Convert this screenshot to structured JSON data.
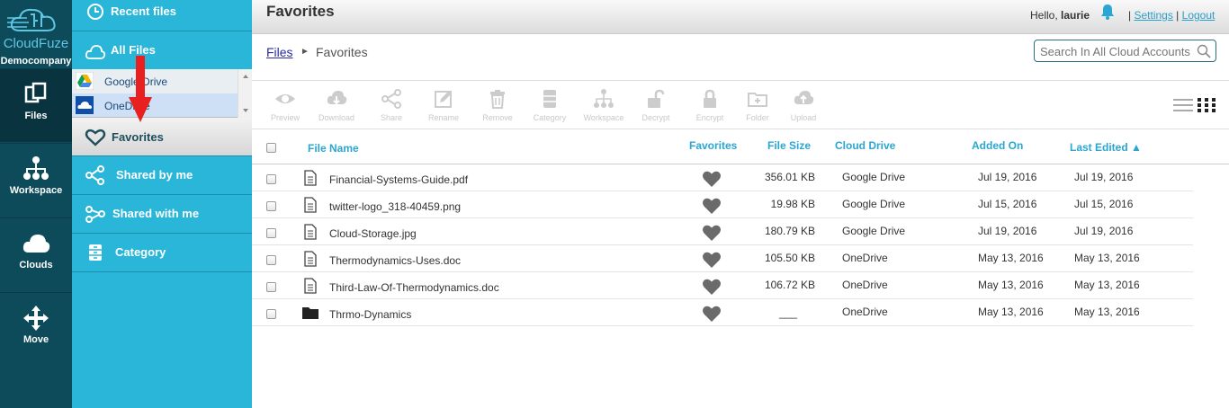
{
  "brand": {
    "name": "CloudFuze",
    "company": "Democompany"
  },
  "rail": [
    {
      "label": "Files",
      "icon": "files-icon"
    },
    {
      "label": "Workspace",
      "icon": "workspace-icon"
    },
    {
      "label": "Clouds",
      "icon": "clouds-icon"
    },
    {
      "label": "Move",
      "icon": "move-icon"
    }
  ],
  "sidebar": {
    "recent": "Recent files",
    "all_files": "All Files",
    "clouds": [
      {
        "label": "Google Drive",
        "icon": "google-drive-icon"
      },
      {
        "label": "OneDrive",
        "icon": "onedrive-icon"
      }
    ],
    "favorites": "Favorites",
    "shared_by_me": "Shared by me",
    "shared_with_me": "Shared with me",
    "category": "Category"
  },
  "header": {
    "title": "Favorites",
    "hello": "Hello,",
    "user": "laurie",
    "settings": "Settings",
    "logout": "Logout",
    "sep": "|"
  },
  "breadcrumb": {
    "root": "Files",
    "sep": "►",
    "current": "Favorites"
  },
  "search": {
    "placeholder": "Search In All Cloud Accounts"
  },
  "toolbar": [
    {
      "label": "Preview",
      "icon": "eye-icon"
    },
    {
      "label": "Download",
      "icon": "cloud-download-icon"
    },
    {
      "label": "Share",
      "icon": "share-icon"
    },
    {
      "label": "Rename",
      "icon": "rename-icon"
    },
    {
      "label": "Remove",
      "icon": "trash-icon"
    },
    {
      "label": "Category",
      "icon": "category-icon"
    },
    {
      "label": "Workspace",
      "icon": "workspace-icon"
    },
    {
      "label": "Decrypt",
      "icon": "unlock-icon"
    },
    {
      "label": "Encrypt",
      "icon": "lock-icon"
    },
    {
      "label": "Folder",
      "icon": "new-folder-icon"
    },
    {
      "label": "Upload",
      "icon": "cloud-upload-icon"
    }
  ],
  "table": {
    "headers": {
      "name": "File Name",
      "favorites": "Favorites",
      "size": "File Size",
      "cloud": "Cloud Drive",
      "added": "Added On",
      "edited": "Last Edited ▲"
    },
    "rows": [
      {
        "name": "Financial-Systems-Guide.pdf",
        "type": "file",
        "size": "356.01 KB",
        "cloud": "Google Drive",
        "added": "Jul 19, 2016",
        "edited": "Jul 19, 2016"
      },
      {
        "name": "twitter-logo_318-40459.png",
        "type": "file",
        "size": "19.98 KB",
        "cloud": "Google Drive",
        "added": "Jul 15, 2016",
        "edited": "Jul 15, 2016"
      },
      {
        "name": "Cloud-Storage.jpg",
        "type": "file",
        "size": "180.79 KB",
        "cloud": "Google Drive",
        "added": "Jul 19, 2016",
        "edited": "Jul 19, 2016"
      },
      {
        "name": "Thermodynamics-Uses.doc",
        "type": "file",
        "size": "105.50 KB",
        "cloud": "OneDrive",
        "added": "May 13, 2016",
        "edited": "May 13, 2016"
      },
      {
        "name": "Third-Law-Of-Thermodynamics.doc",
        "type": "file",
        "size": "106.72 KB",
        "cloud": "OneDrive",
        "added": "May 13, 2016",
        "edited": "May 13, 2016"
      },
      {
        "name": "Thrmo-Dynamics",
        "type": "folder",
        "size": "___",
        "cloud": "OneDrive",
        "added": "May 13, 2016",
        "edited": "May 13, 2016"
      }
    ]
  },
  "colors": {
    "rail": "#0d4a5a",
    "sidebar": "#29b6d9",
    "accent": "#2aa6d2",
    "annotation": "#e82020"
  }
}
